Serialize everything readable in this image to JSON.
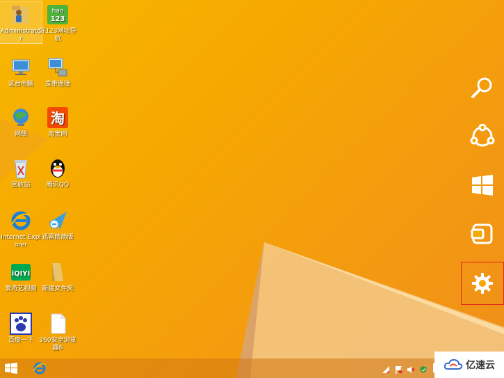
{
  "desktop": {
    "icons": [
      {
        "label": "Administrator",
        "icon": "user-folder-icon",
        "selected": true
      },
      {
        "label": "好123网址导航",
        "icon": "hao123-icon"
      },
      {
        "label": "这台电脑",
        "icon": "computer-icon"
      },
      {
        "label": "宽带连接",
        "icon": "network-connection-icon"
      },
      {
        "label": "网络",
        "icon": "network-globe-icon"
      },
      {
        "label": "淘宝网",
        "icon": "taobao-icon",
        "glyph": "淘"
      },
      {
        "label": "回收站",
        "icon": "recycle-bin-icon"
      },
      {
        "label": "腾讯QQ",
        "icon": "qq-penguin-icon"
      },
      {
        "label": "Internet Explorer",
        "icon": "internet-explorer-icon"
      },
      {
        "label": "迅雷精简版",
        "icon": "xunlei-bird-icon"
      },
      {
        "label": "爱奇艺视频",
        "icon": "iqiyi-icon",
        "glyph": "iQIYI"
      },
      {
        "label": "新建文件夹",
        "icon": "folder-icon"
      },
      {
        "label": "百度一下",
        "icon": "baidu-paw-icon"
      },
      {
        "label": "360安全浏览器6",
        "icon": "document-icon"
      }
    ],
    "hao_badge": {
      "line1": "hao",
      "line2": "123"
    }
  },
  "charms": [
    {
      "name": "search",
      "icon": "search-icon"
    },
    {
      "name": "share",
      "icon": "share-icon"
    },
    {
      "name": "start",
      "icon": "windows-start-icon"
    },
    {
      "name": "devices",
      "icon": "devices-icon"
    },
    {
      "name": "settings",
      "icon": "gear-icon",
      "selected": true
    }
  ],
  "taskbar": {
    "ime_indicator": "M",
    "tray_icons": [
      "network-signal-icon",
      "flag-icon",
      "volume-muted-icon",
      "security-shield-icon"
    ]
  },
  "watermark": {
    "text": "亿速云"
  },
  "colors": {
    "wallpaper": "#f6a800",
    "charm_highlight": "#e0261e"
  }
}
